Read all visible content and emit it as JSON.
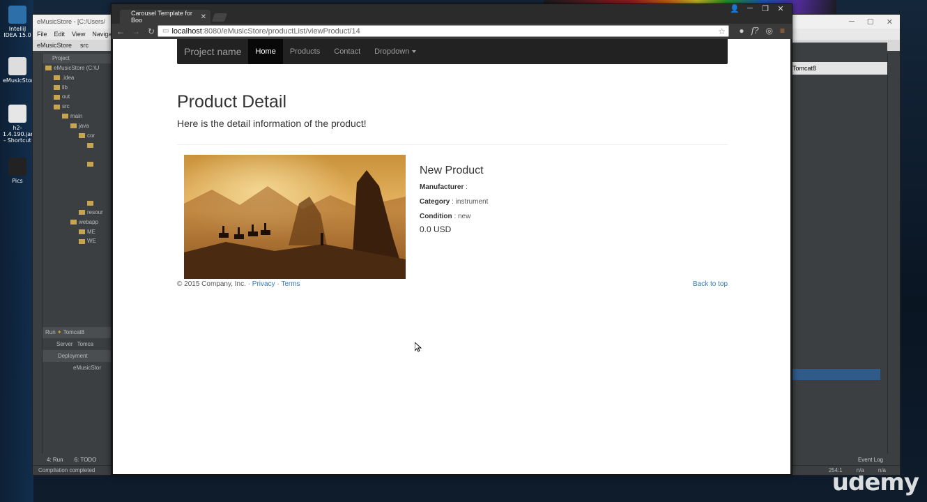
{
  "desktop": {
    "icons": [
      {
        "label": "IntelliJ IDEA 15.0"
      },
      {
        "label": "eMusicStore"
      },
      {
        "label": "h2-1.4.190.jar - Shortcut"
      },
      {
        "label": "Pics"
      }
    ],
    "watermark": "udemy"
  },
  "ide": {
    "title": "eMusicStore - [C:/Users/",
    "menu": [
      "File",
      "Edit",
      "View",
      "Navigate"
    ],
    "breadcrumbs": [
      "eMusicStore",
      "src"
    ],
    "project_header": "Project",
    "tree": [
      "eMusicStore (C:\\U",
      ".idea",
      "lib",
      "out",
      "src",
      "main",
      "java",
      "cor",
      "",
      "",
      "",
      "",
      "resour",
      "webapp",
      "ME",
      "WE",
      "",
      "",
      ""
    ],
    "run_label": "Run",
    "run_config": "Tomcat8",
    "server_tab": "Server",
    "tomcat_tab": "Tomca",
    "deployment_label": "Deployment",
    "deployment_item": "eMusicStor",
    "right_config": "Tomcat8",
    "bottom_tabs": [
      "4: Run",
      "6: TODO"
    ],
    "status": "Compilation completed",
    "event_log": "Event Log",
    "position": "254:1",
    "na1": "n/a",
    "na2": "n/a"
  },
  "browser": {
    "tab_title": "Carousel Template for Boo",
    "url_host": "localhost",
    "url_path": ":8080/eMusicStore/productList/viewProduct/14"
  },
  "page": {
    "navbar": {
      "brand": "Project name",
      "items": [
        "Home",
        "Products",
        "Contact",
        "Dropdown"
      ]
    },
    "title": "Product Detail",
    "lead": "Here is the detail information of the product!",
    "product": {
      "name": "New Product",
      "manufacturer_label": "Manufacturer",
      "manufacturer_value": ":",
      "category_label": "Category",
      "category_value": ": instrument",
      "condition_label": "Condition",
      "condition_value": ": new",
      "price": "0.0 USD"
    },
    "footer": {
      "copyright": "© 2015 Company, Inc. ·",
      "privacy": "Privacy",
      "sep": "·",
      "terms": "Terms",
      "back_to_top": "Back to top"
    }
  },
  "colors": {
    "navbar_bg": "#222222",
    "link": "#337ab7"
  }
}
